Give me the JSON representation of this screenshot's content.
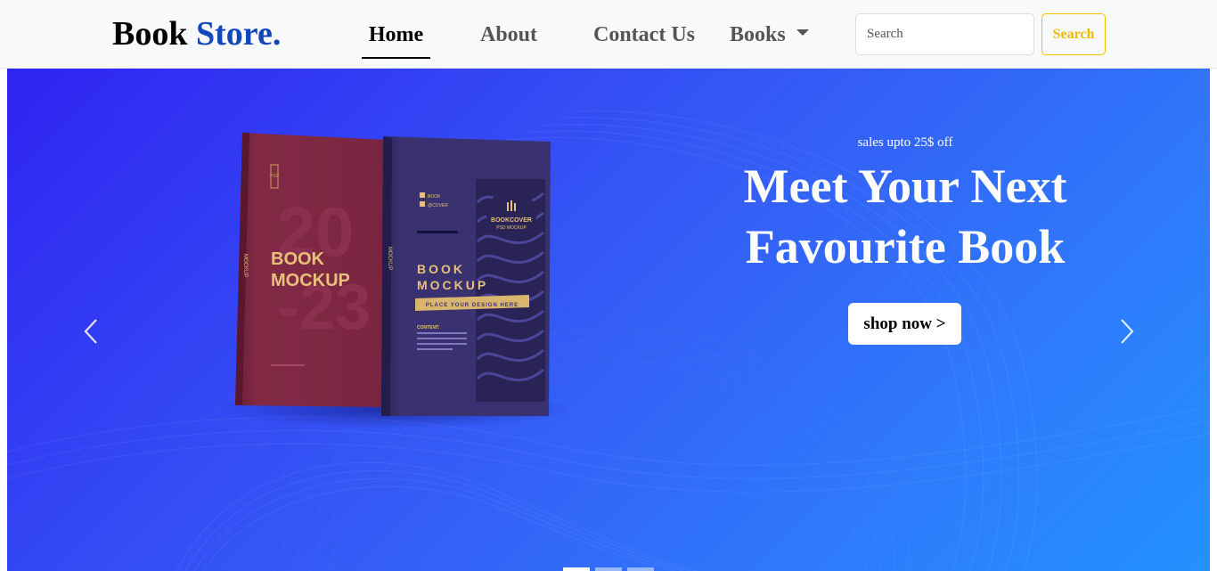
{
  "brand": {
    "part1": "Book",
    "part2": "Store.",
    "part2_color": "#1147b8"
  },
  "nav": {
    "home": "Home",
    "about": "About",
    "contact": "Contact Us",
    "books": "Books"
  },
  "search": {
    "placeholder": "Search",
    "button_label": "Search",
    "accent": "#f2b800"
  },
  "carousel": {
    "subtitle": "sales upto 25$ off",
    "title_line1": "Meet Your Next",
    "title_line2": "Favourite Book",
    "cta_label": "shop now >",
    "gradient": [
      "#3024f2",
      "#2392fe"
    ],
    "active_slide": 1,
    "slide_count": 3
  },
  "book_covers": {
    "left": {
      "tag": "PSD",
      "big_number_top": "20",
      "big_number_bottom": "-23",
      "title_line1": "BOOK",
      "title_line2": "MOCKUP",
      "spine": "MOCKUP",
      "color": "#7a2540"
    },
    "right": {
      "item1": "BOOK",
      "item2": "@COVER",
      "title_line1": "BOOK",
      "title_line2": "MOCKUP",
      "banner": "PLACE YOUR DESIGN HERE",
      "content_label": "CONTENT:",
      "badge_line1": "BOOKCOVER",
      "badge_line2": "PSD MOCKUP",
      "spine": "MOCKUP",
      "color": "#3a3270"
    }
  }
}
